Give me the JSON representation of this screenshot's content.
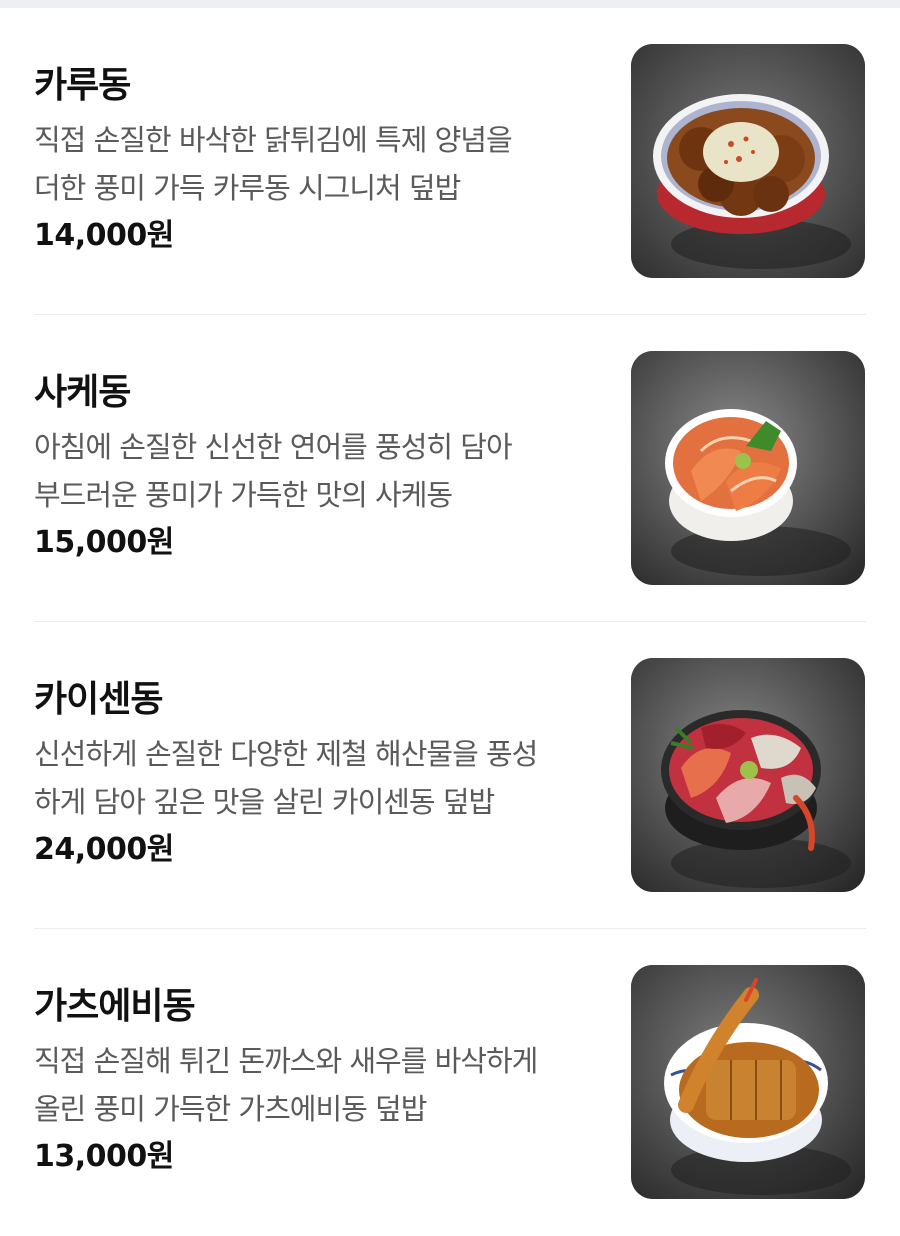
{
  "menu": {
    "items": [
      {
        "name": "카루동",
        "description_lines": [
          "직접 손질한 바삭한 닭튀김에 특제 양념을",
          "더한 풍미 가득 카루동 시그니처 덮밥"
        ],
        "price": "14,000원",
        "photo_icon": "karaage-bowl-photo"
      },
      {
        "name": "사케동",
        "description_lines": [
          "아침에 손질한 신선한 연어를 풍성히 담아",
          "부드러운 풍미가 가득한 맛의 사케동"
        ],
        "price": "15,000원",
        "photo_icon": "salmon-bowl-photo"
      },
      {
        "name": "카이센동",
        "description_lines": [
          "신선하게 손질한 다양한 제철 해산물을 풍성",
          "하게 담아 깊은 맛을 살린 카이센동 덮밥"
        ],
        "price": "24,000원",
        "photo_icon": "seafood-bowl-photo"
      },
      {
        "name": "가츠에비동",
        "description_lines": [
          "직접 손질해 튀긴 돈까스와 새우를 바삭하게",
          "올린 풍미 가득한 가츠에비동 덮밥"
        ],
        "price": "13,000원",
        "photo_icon": "katsu-ebi-bowl-photo"
      }
    ]
  },
  "colors": {
    "background": "#ffffff",
    "title": "#111111",
    "description": "#5a5a5a",
    "divider": "#ececec",
    "top_strip": "#eeeff1"
  }
}
